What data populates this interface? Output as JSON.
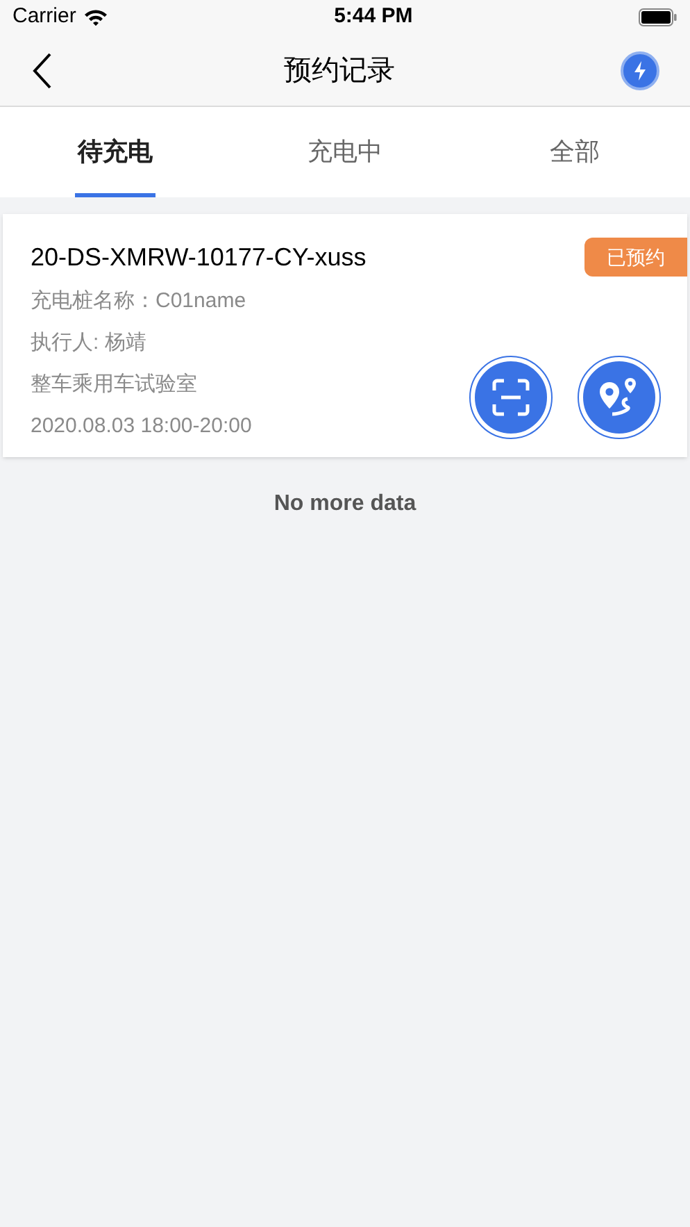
{
  "status_bar": {
    "carrier": "Carrier",
    "time": "5:44 PM"
  },
  "nav": {
    "title": "预约记录"
  },
  "tabs": [
    {
      "label": "待充电",
      "selected": true
    },
    {
      "label": "充电中",
      "selected": false
    },
    {
      "label": "全部",
      "selected": false
    }
  ],
  "records": [
    {
      "code": "20-DS-XMRW-10177-CY-xuss",
      "status": "已预约",
      "lines": [
        "充电桩名称：C01name",
        "执行人: 杨靖",
        "整车乘用车试验室",
        "2020.08.03 18:00-20:00"
      ]
    }
  ],
  "footer": "No more data"
}
